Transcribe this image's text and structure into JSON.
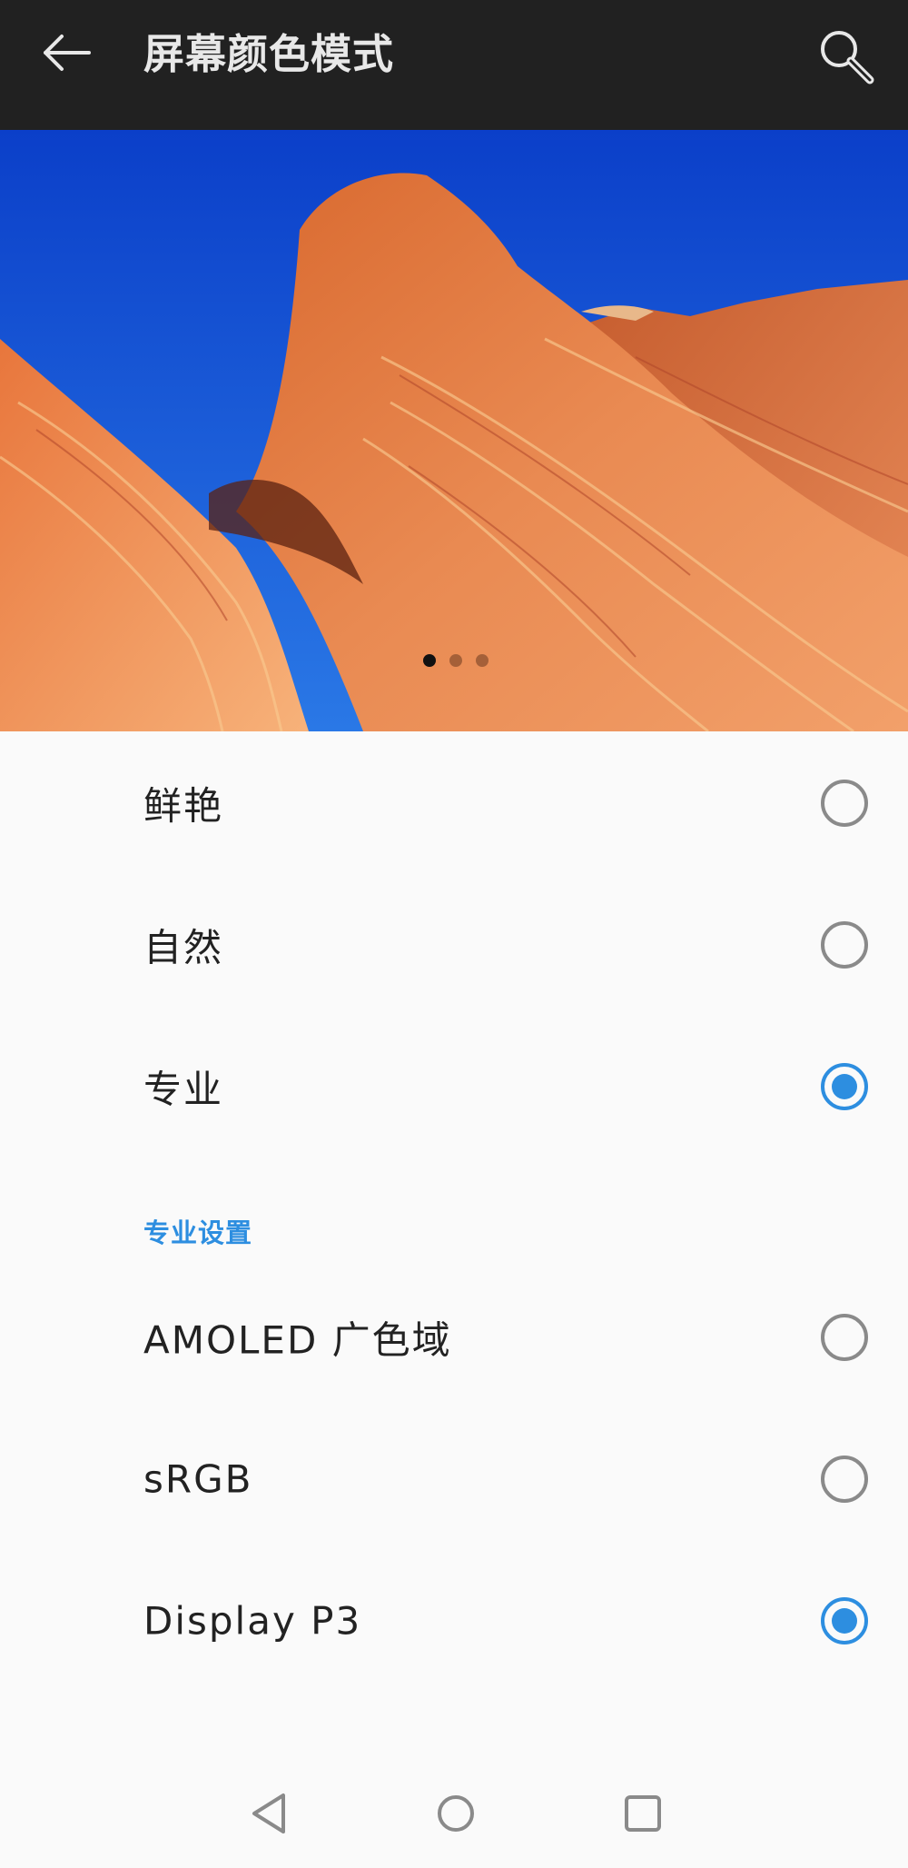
{
  "app_bar": {
    "title": "屏幕颜色模式",
    "back_icon": "arrow-left-icon",
    "search_icon": "search-icon"
  },
  "preview": {
    "image": "sandstone-wave-photo",
    "pages": 3,
    "active_page": 1
  },
  "color_modes": [
    {
      "label": "鲜艳",
      "selected": false
    },
    {
      "label": "自然",
      "selected": false
    },
    {
      "label": "专业",
      "selected": true
    }
  ],
  "pro_settings": {
    "header": "专业设置",
    "options": [
      {
        "label": "AMOLED 广色域",
        "selected": false
      },
      {
        "label": "sRGB",
        "selected": false
      },
      {
        "label": "Display P3",
        "selected": true
      }
    ]
  },
  "nav_bar": {
    "back": "triangle-back-icon",
    "home": "circle-home-icon",
    "recents": "square-recents-icon"
  },
  "colors": {
    "app_bar": "#212121",
    "accent": "#2d8ee0",
    "background": "#fafafa"
  }
}
